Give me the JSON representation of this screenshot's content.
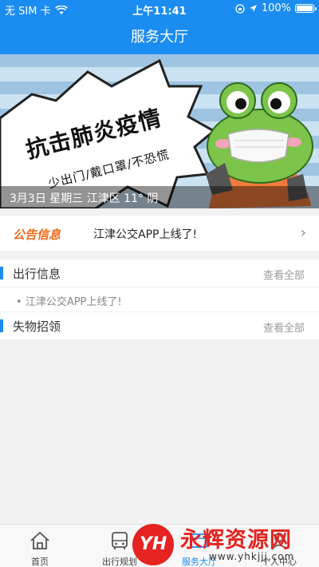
{
  "statusbar": {
    "carrier": "无 SIM 卡",
    "time": "上午11:41",
    "battery": "100%"
  },
  "navbar": {
    "title": "服务大厅"
  },
  "banner": {
    "headline": "抗击肺炎疫情",
    "slogan": "少出门/戴口罩/不恐慌",
    "info": "3月3日 星期三 江津区 11° 阴"
  },
  "notice": {
    "tag": "公告信息",
    "text": "江津公交APP上线了!"
  },
  "travel": {
    "title": "出行信息",
    "more": "查看全部",
    "items": [
      "江津公交APP上线了!"
    ]
  },
  "lost": {
    "title": "失物招领",
    "more": "查看全部"
  },
  "tabs": [
    {
      "label": "首页",
      "icon": "home-icon"
    },
    {
      "label": "出行规划",
      "icon": "bus-icon"
    },
    {
      "label": "服务大厅",
      "icon": "service-icon"
    },
    {
      "label": "个人中心",
      "icon": "person-icon"
    }
  ],
  "watermark": {
    "badge": "YH",
    "name": "永辉资源网",
    "url": "www.yhkjjj.com"
  },
  "colors": {
    "primary": "#1a8cf2",
    "notice_tag": "#ef6b1c",
    "watermark": "#e52320"
  }
}
